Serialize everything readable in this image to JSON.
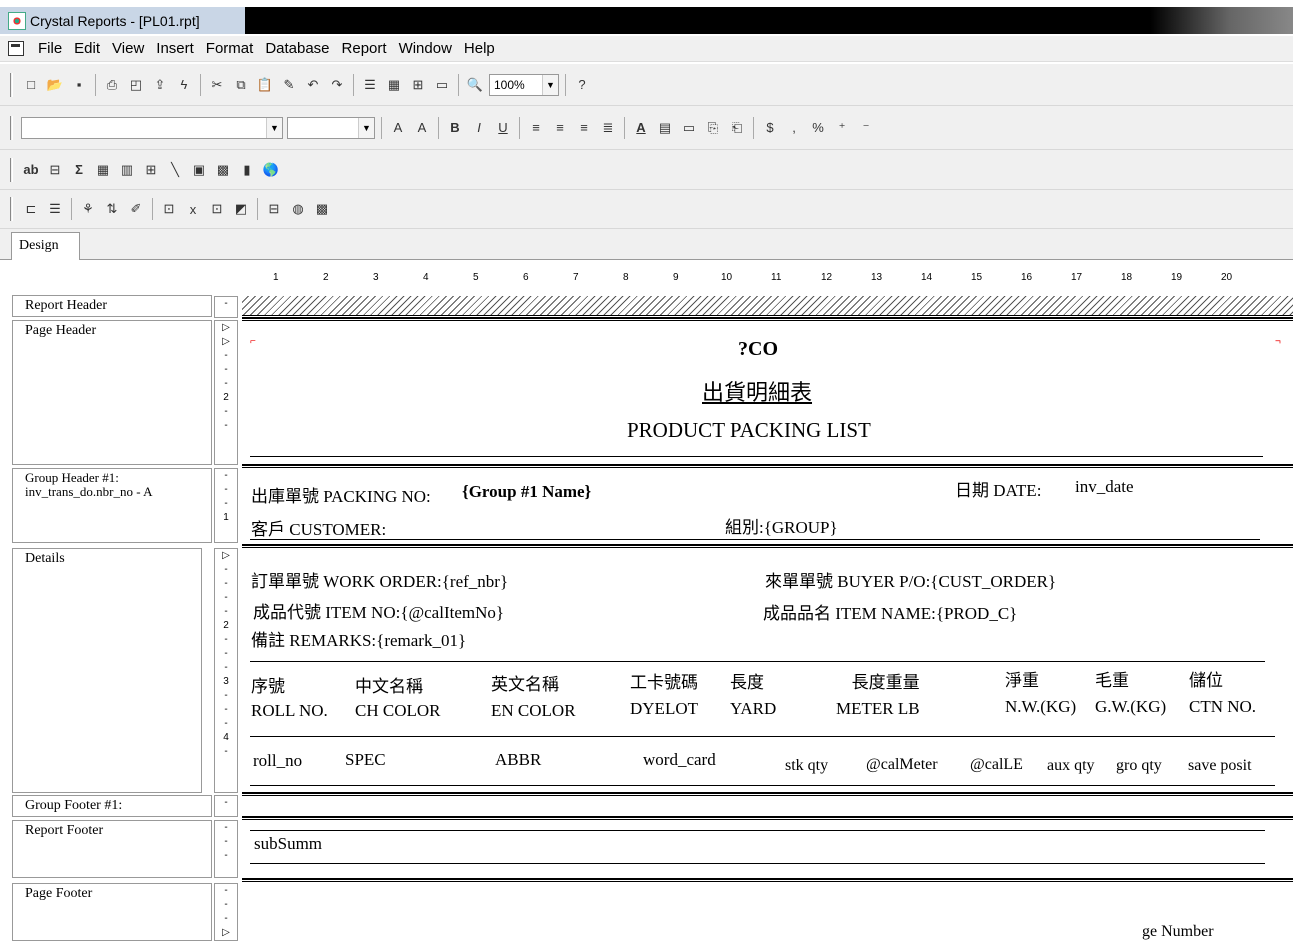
{
  "window": {
    "title": "Crystal Reports - [PL01.rpt]"
  },
  "menu": [
    "File",
    "Edit",
    "View",
    "Insert",
    "Format",
    "Database",
    "Report",
    "Window",
    "Help"
  ],
  "toolbar": {
    "zoom": "100%"
  },
  "tabs": {
    "design": "Design"
  },
  "ruler": [
    "1",
    "2",
    "3",
    "4",
    "5",
    "6",
    "7",
    "8",
    "9",
    "10",
    "11",
    "12",
    "13",
    "14",
    "15",
    "16",
    "17",
    "18",
    "19",
    "20"
  ],
  "sections": {
    "report_header": "Report Header",
    "page_header": "Page Header",
    "group_header": "Group Header #1:",
    "group_header_field": "inv_trans_do.nbr_no - A",
    "details": "Details",
    "group_footer": "Group Footer #1:",
    "report_footer": "Report Footer",
    "page_footer": "Page Footer"
  },
  "page_header": {
    "company": "?CO",
    "title_cn": "出貨明細表",
    "title_en": "PRODUCT PACKING LIST"
  },
  "group_header": {
    "packing_no_label": "出庫單號 PACKING NO:",
    "packing_no_field": "{Group #1 Name}",
    "date_label": "日期 DATE:",
    "date_field": "inv_date",
    "customer_label": "客戶 CUSTOMER:",
    "group_label": "組別:{GROUP}"
  },
  "details": {
    "work_order": "訂單單號 WORK ORDER:{ref_nbr}",
    "buyer_po": "來單單號 BUYER P/O:{CUST_ORDER}",
    "item_no": "成品代號 ITEM NO:{@calItemNo}",
    "item_name": "成品品名 ITEM NAME:{PROD_C}",
    "remarks": "備註 REMARKS:{remark_01}",
    "col_headers": [
      {
        "cn": "序號",
        "en": "ROLL NO."
      },
      {
        "cn": "中文名稱",
        "en": "CH COLOR"
      },
      {
        "cn": "英文名稱",
        "en": "EN COLOR"
      },
      {
        "cn": "工卡號碼",
        "en": "DYELOT"
      },
      {
        "cn": "長度",
        "en": "YARD"
      },
      {
        "cn": "長度重量",
        "en": "METER LB"
      },
      {
        "cn": "淨重",
        "en": "N.W.(KG)"
      },
      {
        "cn": "毛重",
        "en": "G.W.(KG)"
      },
      {
        "cn": "儲位",
        "en": "CTN NO."
      }
    ],
    "fields": [
      "roll_no",
      "SPEC",
      "ABBR",
      "word_card",
      "stk qty",
      "@calMeter",
      "@calLE",
      "aux qty",
      "gro qty",
      "save posit"
    ]
  },
  "report_footer": {
    "subreport": "subSumm"
  },
  "page_footer": {
    "page_number": "ge Number"
  }
}
